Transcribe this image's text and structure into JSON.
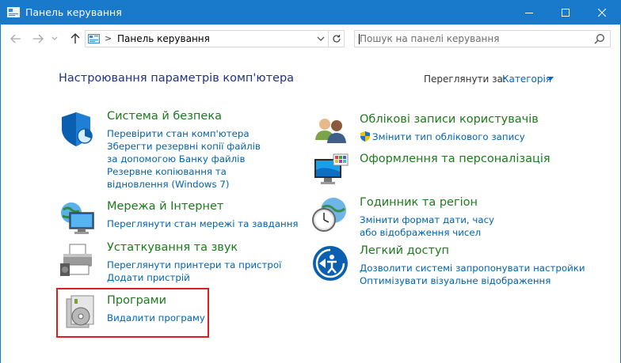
{
  "window": {
    "title": "Панель керування"
  },
  "navbar": {
    "address_text": "Панель керування",
    "address_separator": ">",
    "search_placeholder": "Пошук на панелі керування"
  },
  "content": {
    "page_title": "Настроювання параметрів комп'ютера",
    "view_by_label": "Переглянути за:",
    "view_by_value": "Категорія"
  },
  "categories": {
    "system": {
      "title": "Система й безпека",
      "links": [
        "Перевірити стан комп'ютера",
        "Зберегти резервні копії файлів за допомогою Банку файлів",
        "Резервне копіювання та відновлення (Windows 7)"
      ]
    },
    "network": {
      "title": "Мережа й Інтернет",
      "links": [
        "Переглянути стан мережі та завдання"
      ]
    },
    "hardware": {
      "title": "Устаткування та звук",
      "links": [
        "Переглянути принтери та пристрої",
        "Додати пристрій"
      ]
    },
    "programs": {
      "title": "Програми",
      "links": [
        "Видалити програму"
      ]
    },
    "users": {
      "title": "Облікові записи користувачів",
      "links": [
        "Змінити тип облікового запису"
      ]
    },
    "appearance": {
      "title": "Оформлення та персоналізація"
    },
    "clock": {
      "title": "Годинник та регіон",
      "links": [
        "Змінити формат дати, часу або відображення чисел"
      ]
    },
    "ease": {
      "title": "Легкий доступ",
      "links": [
        "Дозволити системі запропонувати настройки",
        "Оптимізувати візуальне відображення"
      ]
    }
  },
  "colors": {
    "titlebar": "#1979ca",
    "category_title": "#1c7b1c",
    "link": "#0063b1",
    "page_title": "#1e3287",
    "highlight": "#e11b22"
  },
  "icons": {
    "app": "control-panel-icon",
    "system": "shield-icon",
    "network": "globe-monitor-icon",
    "hardware": "printer-icon",
    "programs": "disc-box-icon",
    "users": "users-icon",
    "appearance": "monitor-palette-icon",
    "clock": "clock-globe-icon",
    "ease": "accessibility-icon"
  }
}
